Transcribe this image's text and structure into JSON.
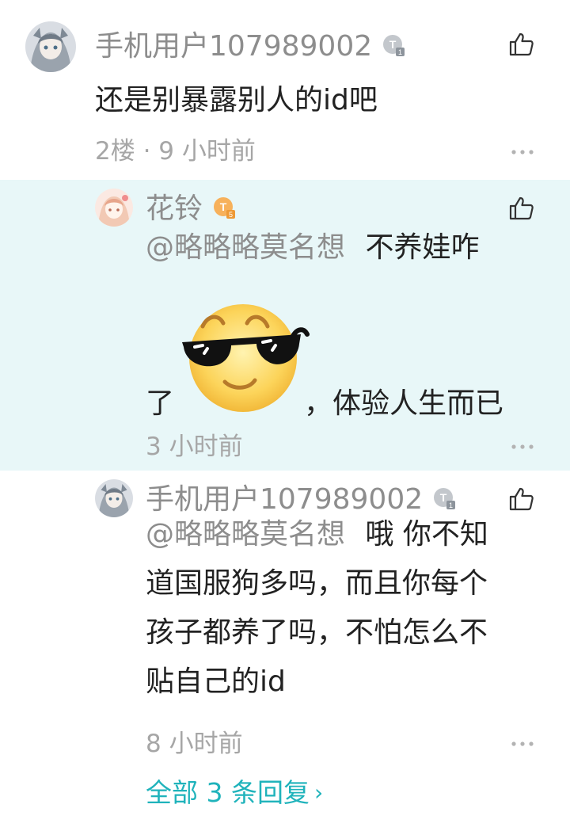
{
  "floor_comment": {
    "username": "手机用户107989002",
    "badge": "T1",
    "text": "还是别暴露别人的id吧",
    "meta": "2楼 · 9 小时前"
  },
  "replies": [
    {
      "username": "花铃",
      "badge": "T5",
      "mention": "@略略略莫名想",
      "text_before_emoji_line1": "不养娃咋",
      "text_before_emoji_line2": "了",
      "emoji": "cool-sunglasses-emoji",
      "text_after_emoji": "，体验人生而已",
      "meta": "3 小时前"
    },
    {
      "username": "手机用户107989002",
      "badge": "T1",
      "mention": "@略略略莫名想",
      "lines": [
        "哦 你不知",
        "道国服狗多吗，而且你每个",
        "孩子都养了吗，不怕怎么不",
        "贴自己的id"
      ],
      "meta": "8 小时前"
    }
  ],
  "more_replies": {
    "label": "全部 3 条回复",
    "icon": "chevron-right-icon"
  },
  "colors": {
    "highlight_bg": "#e8f7f8",
    "accent": "#1fb3bb",
    "muted": "#8d8d8d"
  }
}
